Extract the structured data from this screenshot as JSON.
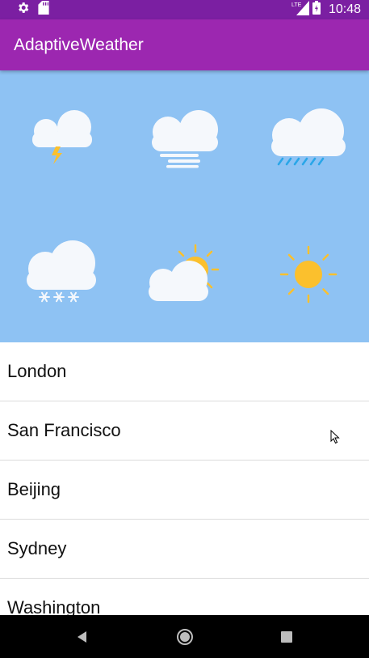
{
  "status_bar": {
    "time": "10:48",
    "network_label": "LTE",
    "icons": [
      "gear-icon",
      "sd-card-icon",
      "signal-icon",
      "battery-icon"
    ]
  },
  "app_bar": {
    "title": "AdaptiveWeather"
  },
  "weather_icons": [
    {
      "name": "thunderstorm-icon"
    },
    {
      "name": "fog-icon"
    },
    {
      "name": "rain-icon"
    },
    {
      "name": "snow-icon"
    },
    {
      "name": "partly-cloudy-icon"
    },
    {
      "name": "sunny-icon"
    }
  ],
  "cities": [
    {
      "label": "London"
    },
    {
      "label": "San Francisco"
    },
    {
      "label": "Beijing"
    },
    {
      "label": "Sydney"
    },
    {
      "label": "Washington"
    }
  ],
  "colors": {
    "status_bar": "#7b1fa2",
    "app_bar": "#9c27b0",
    "weather_background": "#8ec2f3",
    "cloud": "#f5f8fc",
    "sun": "#fbc02d",
    "rain": "#29a6e8"
  }
}
